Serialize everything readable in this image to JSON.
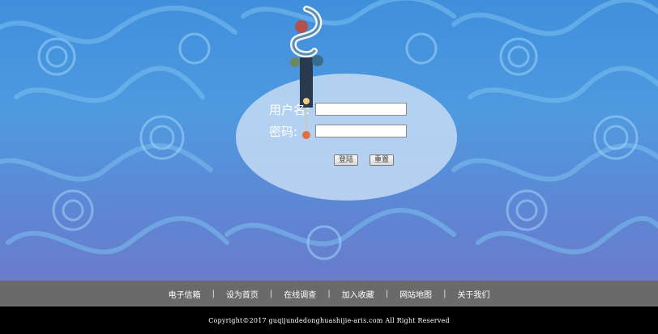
{
  "login": {
    "username_label": "用户名:",
    "password_label": "密码:",
    "username_value": "",
    "password_value": "",
    "login_button": "登陆",
    "reset_button": "重置"
  },
  "nav": {
    "items": [
      "电子信箱",
      "设为首页",
      "在线调查",
      "加入收藏",
      "网站地图",
      "关于我们"
    ],
    "separator": "|"
  },
  "footer": {
    "copyright": "Copyright©2017 guqijundedonghuashijie-aris.com All Right Reserved"
  },
  "colors": {
    "background": "#4f9ae0",
    "nav_bar": "#6a6a6a",
    "footer_bar": "#000000",
    "ellipse": "#d0e2f6"
  },
  "icons": [
    "dragon-emblem-icon"
  ]
}
